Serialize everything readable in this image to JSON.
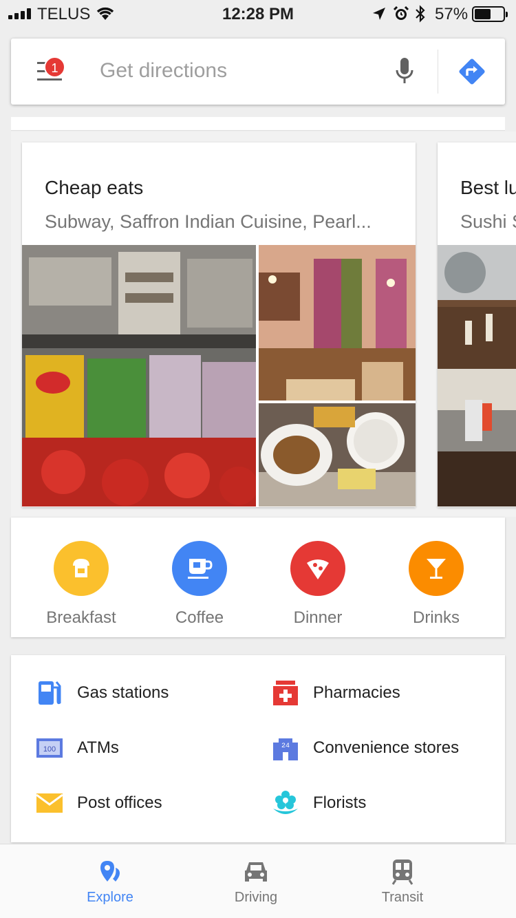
{
  "status_bar": {
    "carrier": "TELUS",
    "time": "12:28 PM",
    "battery_percent": "57%",
    "battery_level": 0.57
  },
  "search": {
    "placeholder": "Get directions",
    "notification_count": "1"
  },
  "carousel": [
    {
      "title": "Cheap eats",
      "subtitle": "Subway, Saffron Indian Cuisine, Pearl..."
    },
    {
      "title": "Best lu",
      "subtitle": "Sushi S"
    }
  ],
  "categories": [
    {
      "label": "Breakfast",
      "icon": "toast-icon",
      "color": "#FBC02D"
    },
    {
      "label": "Coffee",
      "icon": "coffee-cup-icon",
      "color": "#4285F4"
    },
    {
      "label": "Dinner",
      "icon": "pizza-slice-icon",
      "color": "#E53935"
    },
    {
      "label": "Drinks",
      "icon": "cocktail-glass-icon",
      "color": "#FB8C00"
    }
  ],
  "services": [
    {
      "label": "Gas stations",
      "icon": "gas-pump-icon"
    },
    {
      "label": "Pharmacies",
      "icon": "pharmacy-icon"
    },
    {
      "label": "ATMs",
      "icon": "atm-bill-icon"
    },
    {
      "label": "Convenience stores",
      "icon": "convenience-store-icon"
    },
    {
      "label": "Post offices",
      "icon": "envelope-icon"
    },
    {
      "label": "Florists",
      "icon": "flower-icon"
    }
  ],
  "bottom_nav": {
    "tabs": [
      {
        "label": "Explore",
        "icon": "explore-pin-icon",
        "active": true
      },
      {
        "label": "Driving",
        "icon": "car-icon",
        "active": false
      },
      {
        "label": "Transit",
        "icon": "train-icon",
        "active": false
      }
    ]
  },
  "colors": {
    "accent": "#4285F4",
    "inactive": "#757575",
    "badge": "#E53935"
  }
}
